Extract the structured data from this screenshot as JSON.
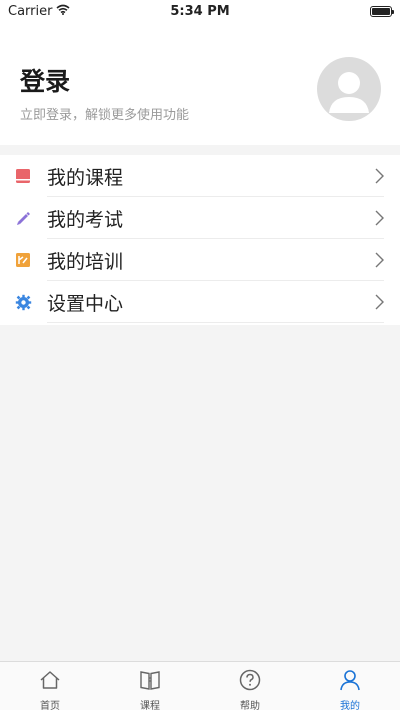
{
  "status_bar": {
    "carrier": "Carrier",
    "time": "5:34 PM"
  },
  "header": {
    "title": "登录",
    "subtitle": "立即登录，解锁更多使用功能"
  },
  "menu": {
    "items": [
      {
        "label": "我的课程",
        "icon": "book-icon",
        "color": "#e9656a"
      },
      {
        "label": "我的考试",
        "icon": "pencil-icon",
        "color": "#8b72d8"
      },
      {
        "label": "我的培训",
        "icon": "training-icon",
        "color": "#f0a23a"
      },
      {
        "label": "设置中心",
        "icon": "gear-icon",
        "color": "#3a86e0"
      }
    ]
  },
  "tabbar": {
    "tabs": [
      {
        "label": "首页",
        "icon": "home-icon",
        "active": false
      },
      {
        "label": "课程",
        "icon": "book-open-icon",
        "active": false
      },
      {
        "label": "帮助",
        "icon": "help-icon",
        "active": false
      },
      {
        "label": "我的",
        "icon": "person-icon",
        "active": true
      }
    ],
    "active_color": "#1a73d6"
  }
}
